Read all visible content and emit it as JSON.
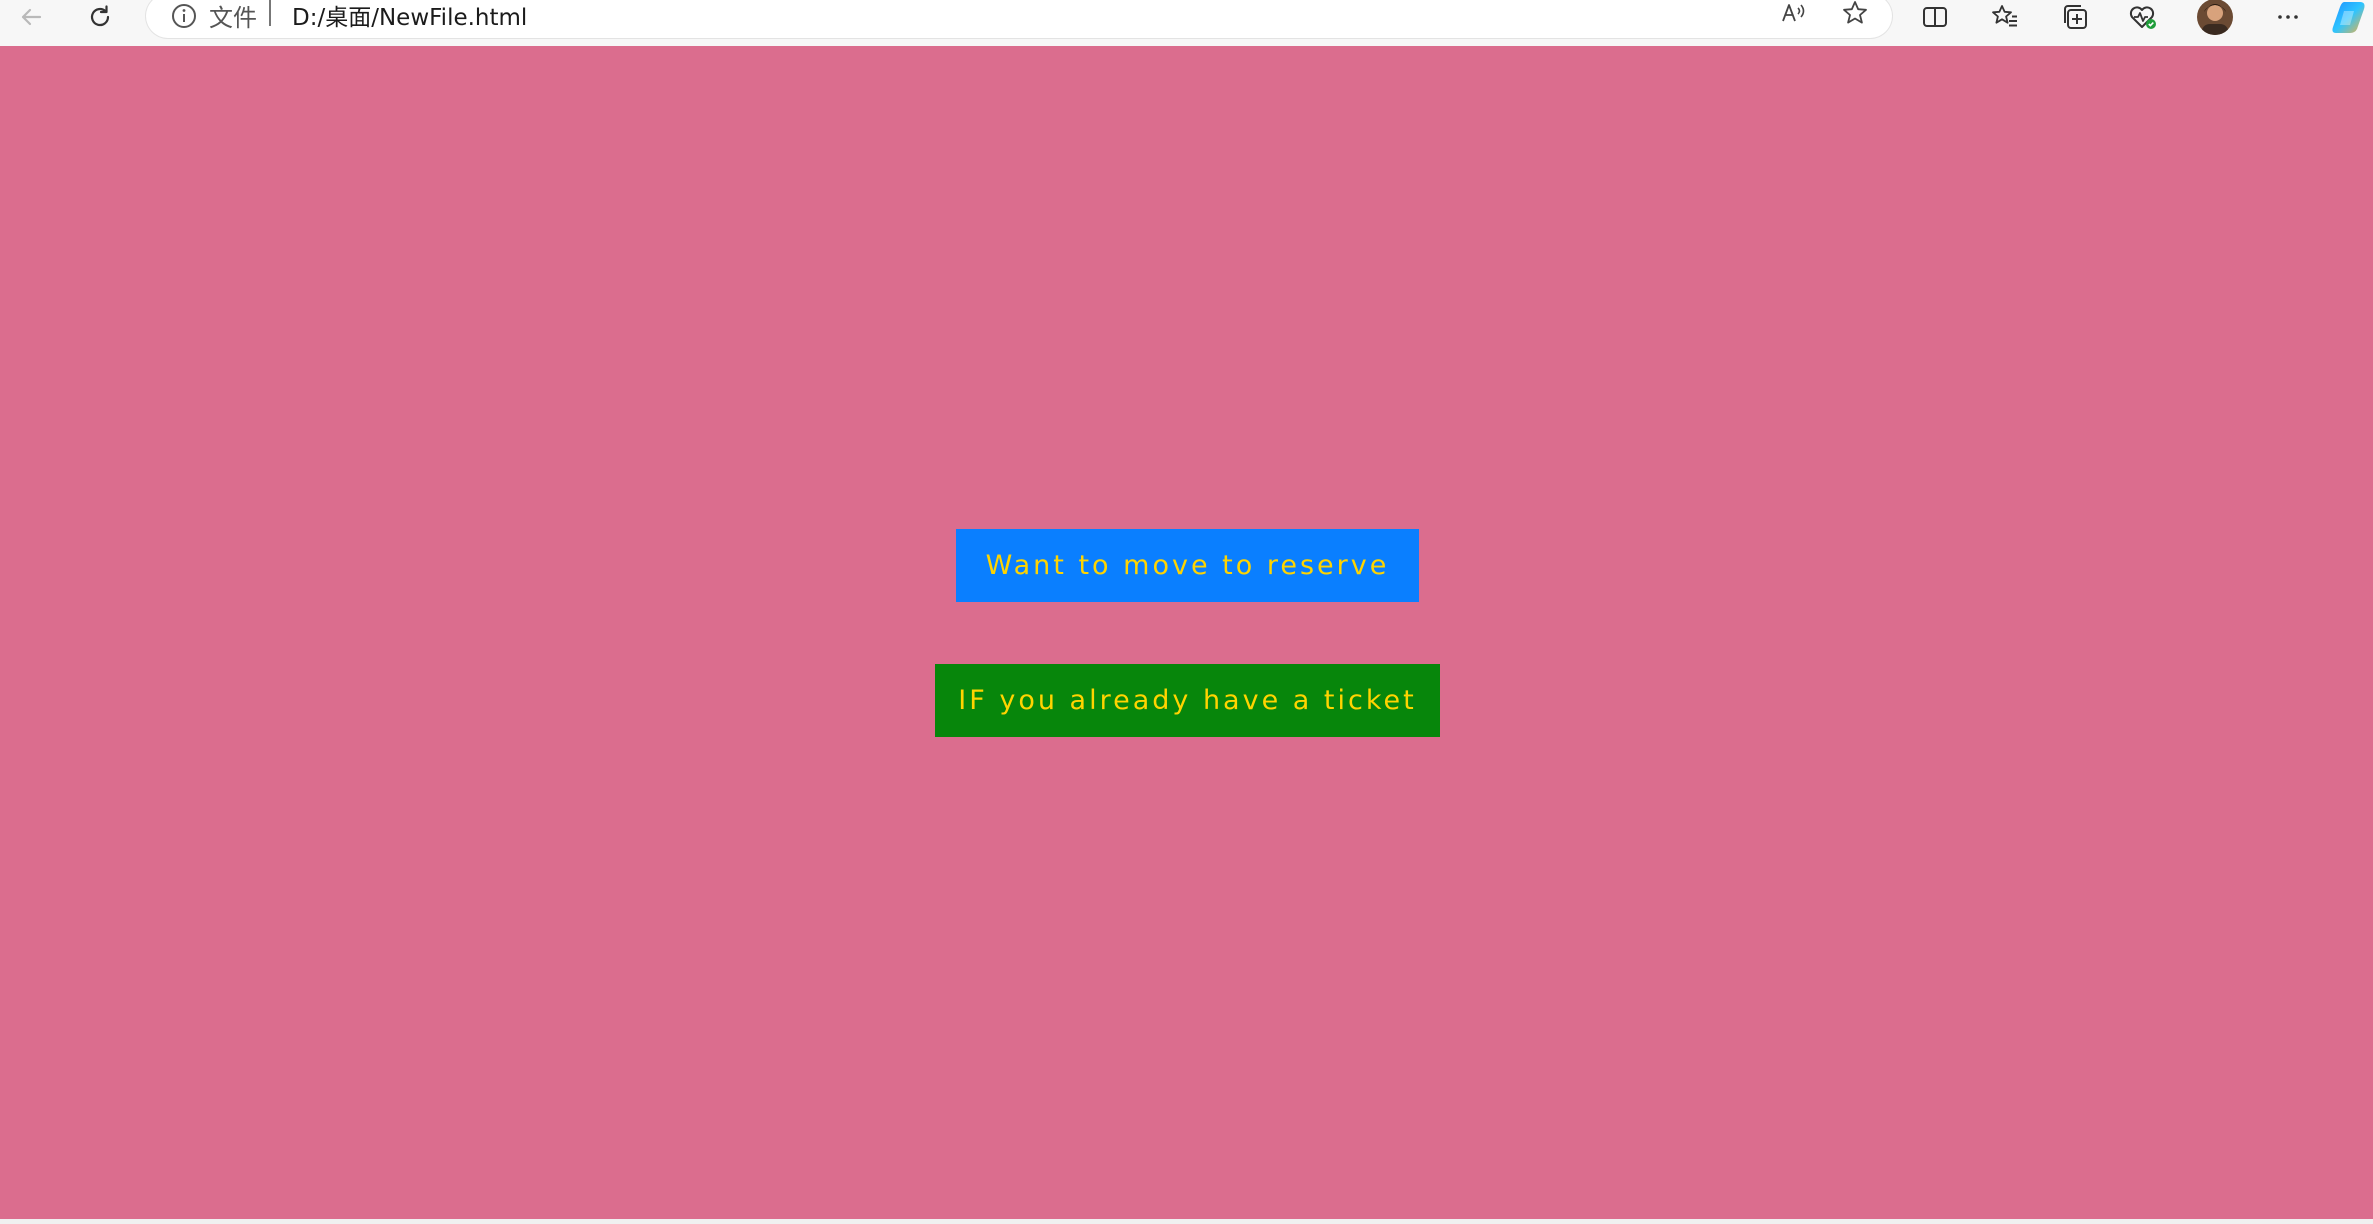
{
  "browser": {
    "address_scheme_label": "文件",
    "address_url": "D:/桌面/NewFile.html",
    "icons": [
      "back-arrow-icon",
      "refresh-icon",
      "info-icon",
      "read-aloud-icon",
      "favorite-star-icon",
      "split-screen-icon",
      "favorites-list-icon",
      "collections-icon",
      "browser-essentials-icon",
      "profile-avatar",
      "more-options-icon",
      "copilot-icon"
    ]
  },
  "page": {
    "background_color": "#db6d8e",
    "reserve_button": {
      "label": "Want to move to reserve",
      "background_color": "#0a7fff",
      "text_color": "#ffd400"
    },
    "ticket_button": {
      "label": "IF you already have a ticket",
      "background_color": "#07860b",
      "text_color": "#ffd400"
    }
  }
}
